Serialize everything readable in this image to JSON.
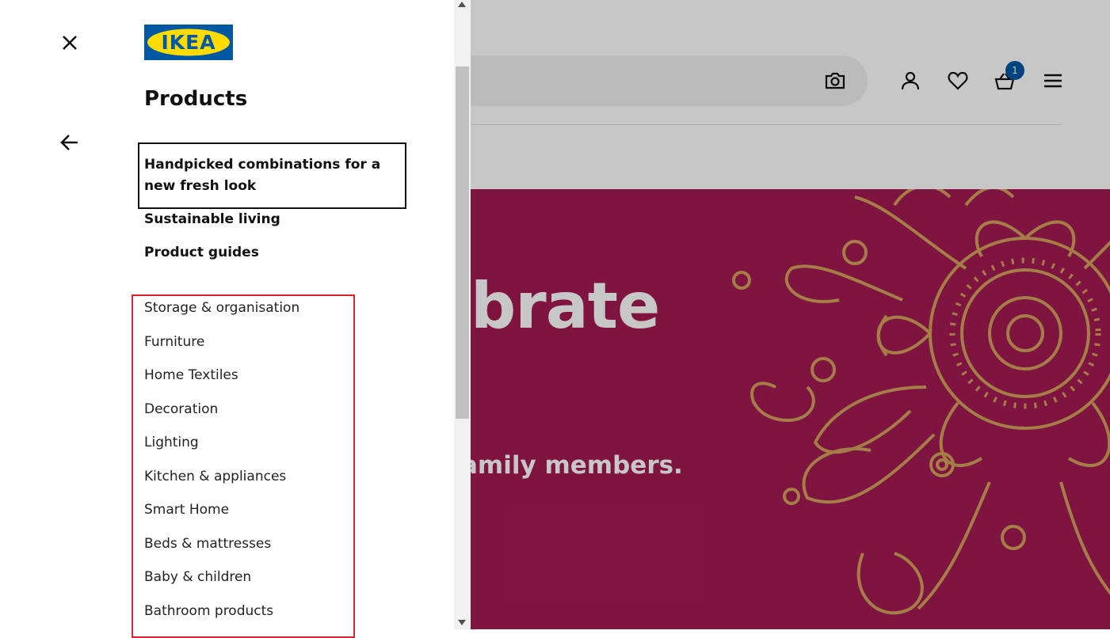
{
  "header": {
    "cart_count": "1"
  },
  "hero": {
    "title_fragment": "brate",
    "subtitle_fragment": "amily members."
  },
  "panel": {
    "title": "Products",
    "logo_text": "IKEA",
    "featured_links": [
      "Handpicked combinations for a new fresh look",
      "Sustainable living",
      "Product guides"
    ],
    "categories": [
      "Storage & organisation",
      "Furniture",
      "Home Textiles",
      "Decoration",
      "Lighting",
      "Kitchen & appliances",
      "Smart Home",
      "Beds & mattresses",
      "Baby & children",
      "Bathroom products"
    ]
  },
  "colors": {
    "hero_bg": "#a51a53",
    "mandala": "#d3a15c",
    "logo_blue": "#0058a3",
    "logo_yellow": "#ffdb00",
    "highlight_box": "#e0202b"
  }
}
